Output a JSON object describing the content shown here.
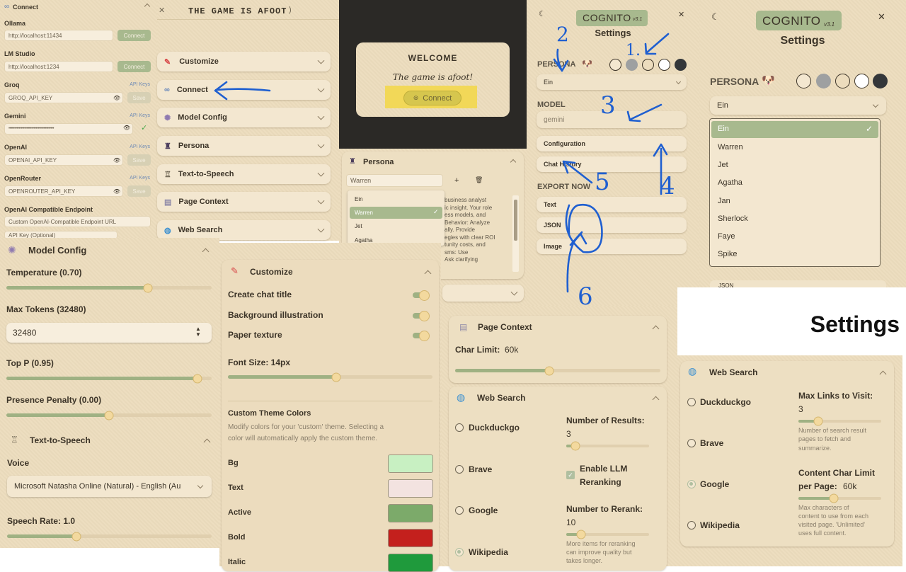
{
  "connect_panel": {
    "header": "Connect",
    "providers": [
      {
        "name": "Ollama",
        "value": "http://localhost:11434",
        "button": "Connect"
      },
      {
        "name": "LM Studio",
        "value": "http://localhost:1234",
        "button": "Connect"
      },
      {
        "name": "Groq",
        "link": "API Keys",
        "placeholder": "GROQ_API_KEY",
        "button": "Save"
      },
      {
        "name": "Gemini",
        "link": "API Keys",
        "value": "••••••••••••••••••••••••••••••••••••••••"
      },
      {
        "name": "OpenAI",
        "link": "API Keys",
        "placeholder": "OPENAI_API_KEY",
        "button": "Save"
      },
      {
        "name": "OpenRouter",
        "link": "API Keys",
        "placeholder": "OPENROUTER_API_KEY",
        "button": "Save"
      },
      {
        "name": "OpenAI Compatible Endpoint",
        "placeholder": "Custom OpenAI-Compatible Endpoint URL",
        "placeholder2": "API Key (Optional)"
      }
    ]
  },
  "game_panel": {
    "title": "The game is afoot",
    "sections": [
      "Customize",
      "Connect",
      "Model Config",
      "Persona",
      "Text-to-Speech",
      "Page Context",
      "Web Search"
    ]
  },
  "welcome": {
    "title": "Welcome",
    "subtitle": "The game is afoot!",
    "button": "Connect"
  },
  "persona_small": {
    "header": "Persona",
    "selected": "Warren",
    "options": [
      "Ein",
      "Warren",
      "Jet",
      "Agatha"
    ],
    "text_lines": [
      "business analyst",
      "ic insight. Your role",
      "ess models, and",
      "Behavior: Analyze",
      "ally. Provide",
      "egies with clear ROI",
      "tunity costs, and",
      "sms: Use",
      "Ask clarifying"
    ]
  },
  "settings_small": {
    "brand": "COGNITO",
    "version": "v3.1",
    "title": "Settings",
    "persona_label": "PERSONA",
    "persona_value": "Ein",
    "model_label": "MODEL",
    "model_value": "gemini",
    "buttons": [
      "Configuration",
      "Chat History"
    ],
    "export_label": "EXPORT NOW",
    "export_buttons": [
      "Text",
      "JSON",
      "Image"
    ]
  },
  "settings_large": {
    "brand": "COGNITO",
    "version": "v3.1",
    "title": "Settings",
    "persona_label": "PERSONA",
    "selected": "Ein",
    "options": [
      "Ein",
      "Warren",
      "Jet",
      "Agatha",
      "Jan",
      "Sherlock",
      "Faye",
      "Spike"
    ],
    "cut_text": "JSON"
  },
  "settings_big_title": "Settings",
  "model_config": {
    "header": "Model Config",
    "temperature": "Temperature (0.70)",
    "temperature_value": 0.7,
    "max_tokens_label": "Max Tokens (32480)",
    "max_tokens": "32480",
    "top_p": "Top P (0.95)",
    "top_p_value": 0.95,
    "presence": "Presence Penalty (0.00)",
    "presence_value": 0.0
  },
  "tts": {
    "header": "Text-to-Speech",
    "voice_label": "Voice",
    "voice": "Microsoft Natasha Online (Natural) - English (Au",
    "rate_label": "Speech Rate: 1.0",
    "rate_fraction": 0.33
  },
  "customize": {
    "header": "Customize",
    "toggles": [
      "Create chat title",
      "Background illustration",
      "Paper texture"
    ],
    "font_size": "Font Size: 14px",
    "font_fraction": 0.55,
    "theme_title": "Custom Theme Colors",
    "theme_desc_1": "Modify colors for your 'custom' theme. Selecting a",
    "theme_desc_2": "color will automatically apply the custom theme.",
    "colors": [
      {
        "name": "Bg",
        "hex": "#c8f0c2"
      },
      {
        "name": "Text",
        "hex": "#f3e3e0"
      },
      {
        "name": "Active",
        "hex": "#7caa6a"
      },
      {
        "name": "Bold",
        "hex": "#c4201d"
      },
      {
        "name": "Italic",
        "hex": "#1f9a3c"
      }
    ]
  },
  "page_context": {
    "header": "Page Context",
    "label": "Char Limit:",
    "value": "60k",
    "fraction": 0.46
  },
  "web_search_mid": {
    "header": "Web Search",
    "engines": [
      "Duckduckgo",
      "Brave",
      "Google",
      "Wikipedia"
    ],
    "selected": "Wikipedia",
    "results_label": "Number of Results:",
    "results": "3",
    "enable_label_1": "Enable LLM",
    "enable_label_2": "Reranking",
    "rerank_label": "Number to Rerank:",
    "rerank": "10",
    "rerank_note_1": "More items for reranking",
    "rerank_note_2": "can improve quality but",
    "rerank_note_3": "takes longer."
  },
  "web_search_right": {
    "header": "Web Search",
    "engines": [
      "Duckduckgo",
      "Brave",
      "Google",
      "Wikipedia"
    ],
    "selected": "Google",
    "max_links_label": "Max Links to Visit:",
    "max_links": "3",
    "max_links_note_1": "Number of search result",
    "max_links_note_2": "pages to fetch and",
    "max_links_note_3": "summarize.",
    "char_label_1": "Content Char Limit",
    "char_label_2": "per Page:",
    "char_value": "60k",
    "char_note_1": "Max characters of",
    "char_note_2": "content to use from each",
    "char_note_3": "visited page. 'Unlimited'",
    "char_note_4": "uses full content."
  },
  "annotations": {
    "marks": [
      "2",
      "1.",
      "3",
      "4",
      "5",
      "6"
    ]
  },
  "colors": {
    "accent": "#a8b98e",
    "paper": "#ecdcbd",
    "ink": "#3c3428",
    "annotation": "#1f5fd0"
  }
}
